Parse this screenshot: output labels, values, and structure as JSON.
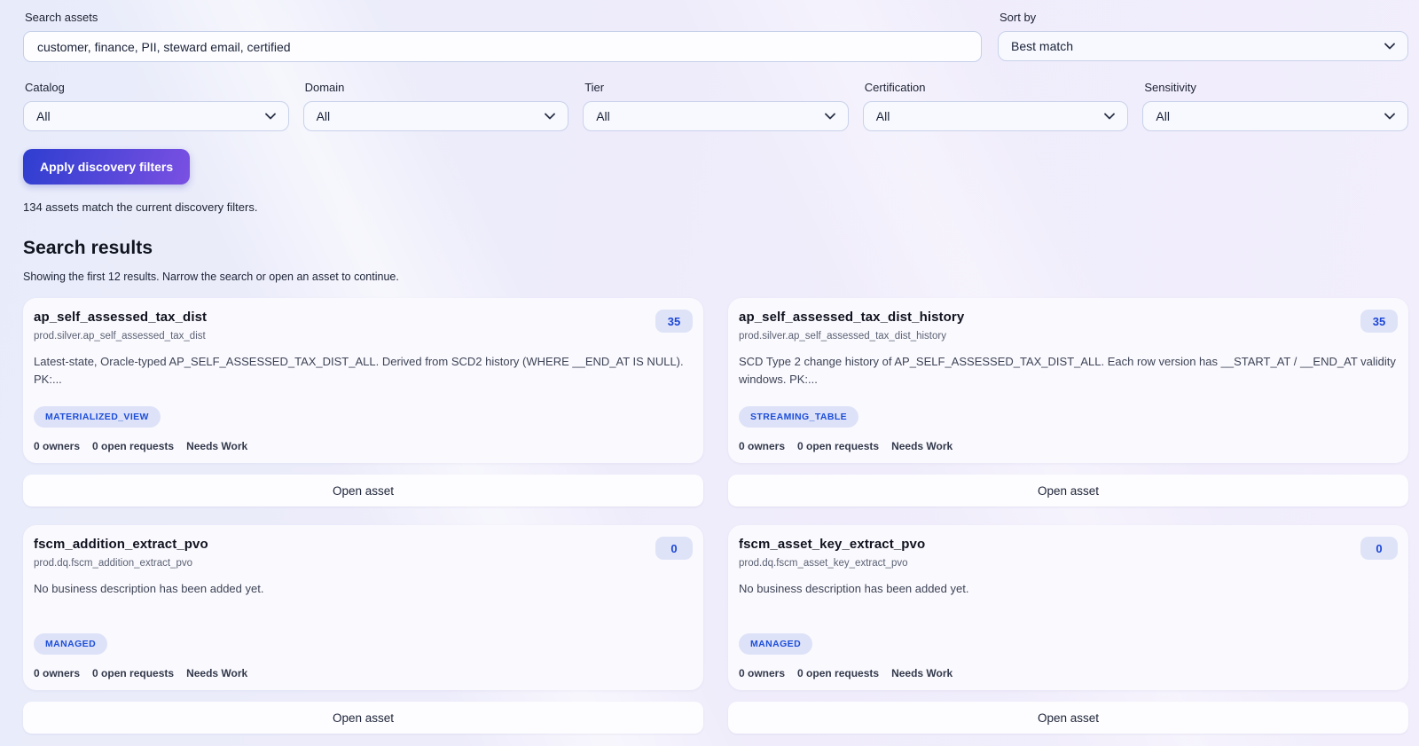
{
  "search": {
    "label": "Search assets",
    "value": "customer, finance, PII, steward email, certified"
  },
  "sort": {
    "label": "Sort by",
    "value": "Best match"
  },
  "filters": [
    {
      "label": "Catalog",
      "value": "All"
    },
    {
      "label": "Domain",
      "value": "All"
    },
    {
      "label": "Tier",
      "value": "All"
    },
    {
      "label": "Certification",
      "value": "All"
    },
    {
      "label": "Sensitivity",
      "value": "All"
    }
  ],
  "apply_button_label": "Apply discovery filters",
  "match_summary": "134 assets match the current discovery filters.",
  "results": {
    "heading": "Search results",
    "subheading": "Showing the first 12 results. Narrow the search or open an asset to continue.",
    "open_asset_label": "Open asset",
    "cards": [
      {
        "title": "ap_self_assessed_tax_dist",
        "path": "prod.silver.ap_self_assessed_tax_dist",
        "description": "Latest-state, Oracle-typed AP_SELF_ASSESSED_TAX_DIST_ALL. Derived from SCD2 history (WHERE __END_AT IS NULL). PK:...",
        "badge": "35",
        "tag": "MATERIALIZED_VIEW",
        "owners": "0 owners",
        "open_requests": "0 open requests",
        "status": "Needs Work"
      },
      {
        "title": "ap_self_assessed_tax_dist_history",
        "path": "prod.silver.ap_self_assessed_tax_dist_history",
        "description": "SCD Type 2 change history of AP_SELF_ASSESSED_TAX_DIST_ALL. Each row version has __START_AT / __END_AT validity windows. PK:...",
        "badge": "35",
        "tag": "STREAMING_TABLE",
        "owners": "0 owners",
        "open_requests": "0 open requests",
        "status": "Needs Work"
      },
      {
        "title": "fscm_addition_extract_pvo",
        "path": "prod.dq.fscm_addition_extract_pvo",
        "description": "No business description has been added yet.",
        "badge": "0",
        "tag": "MANAGED",
        "owners": "0 owners",
        "open_requests": "0 open requests",
        "status": "Needs Work"
      },
      {
        "title": "fscm_asset_key_extract_pvo",
        "path": "prod.dq.fscm_asset_key_extract_pvo",
        "description": "No business description has been added yet.",
        "badge": "0",
        "tag": "MANAGED",
        "owners": "0 owners",
        "open_requests": "0 open requests",
        "status": "Needs Work"
      }
    ]
  },
  "colors": {
    "accent_blue": "#1d4ed8",
    "button_gradient_start": "#2e3ed0",
    "button_gradient_end": "#7a50e2",
    "badge_background": "#dee3f8",
    "page_background": "#efecfb",
    "card_background": "#faf9fe"
  }
}
